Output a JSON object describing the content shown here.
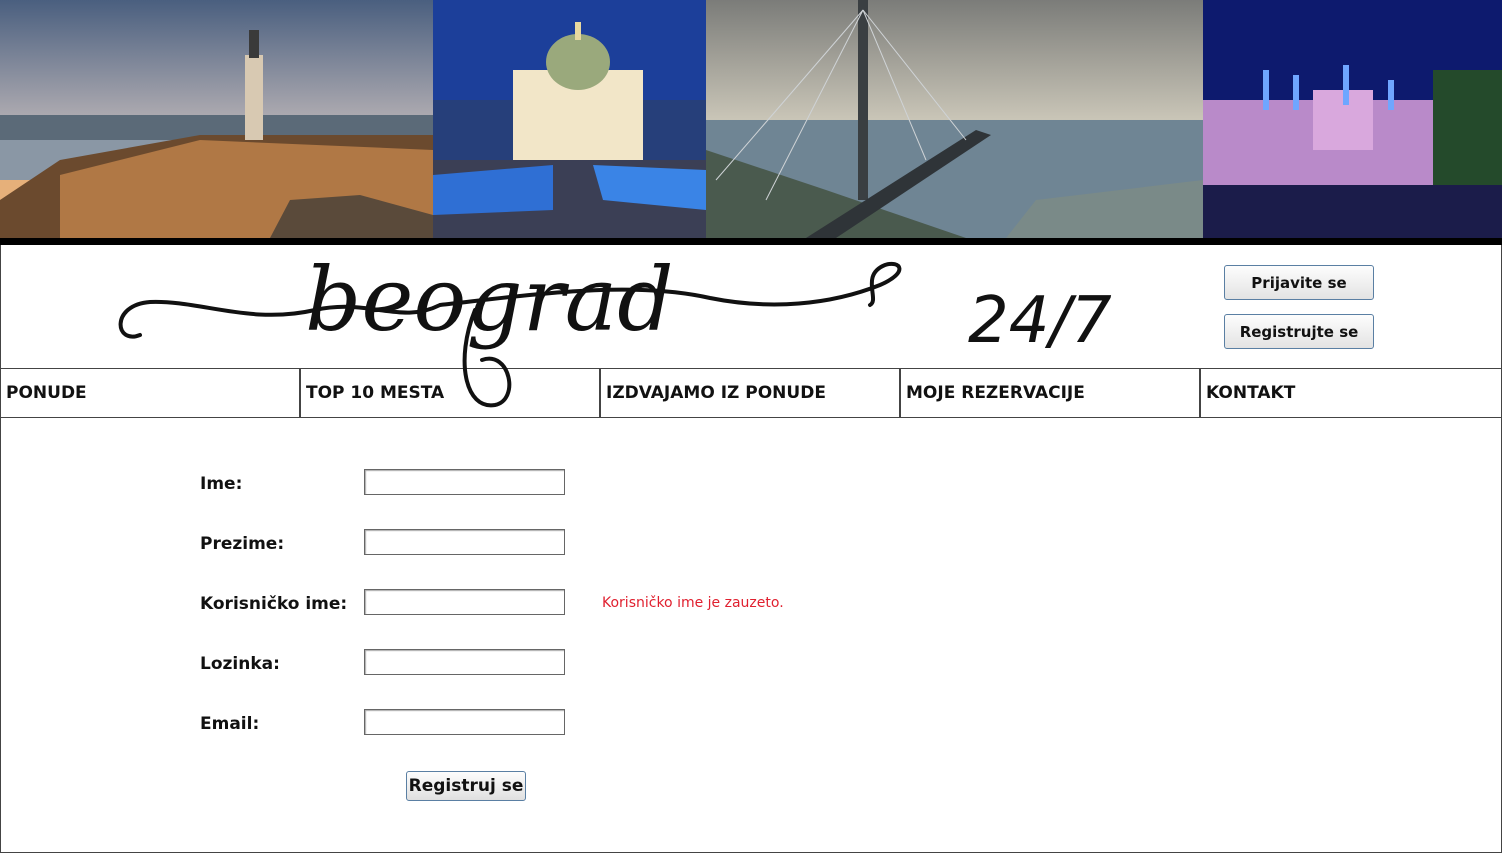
{
  "header": {
    "login_label": "Prijavite se",
    "register_label": "Registrujte se",
    "logo_text": "beograd",
    "logo_suffix": "24/7"
  },
  "nav": {
    "items": [
      {
        "label": "PONUDE"
      },
      {
        "label": "TOP 10 MESTA"
      },
      {
        "label": "IZDVAJAMO IZ PONUDE"
      },
      {
        "label": "MOJE REZERVACIJE"
      },
      {
        "label": "KONTAKT"
      }
    ]
  },
  "form": {
    "fields": [
      {
        "label": "Ime:",
        "value": ""
      },
      {
        "label": "Prezime:",
        "value": ""
      },
      {
        "label": "Korisničko ime:",
        "value": ""
      },
      {
        "label": "Lozinka:",
        "value": ""
      },
      {
        "label": "Email:",
        "value": ""
      }
    ],
    "error": "Korisničko ime je zauzeto.",
    "submit_label": "Registruj se"
  },
  "colors": {
    "error": "#e0202f",
    "button_border": "#5a7fa3",
    "banner_bg": "#000000"
  }
}
